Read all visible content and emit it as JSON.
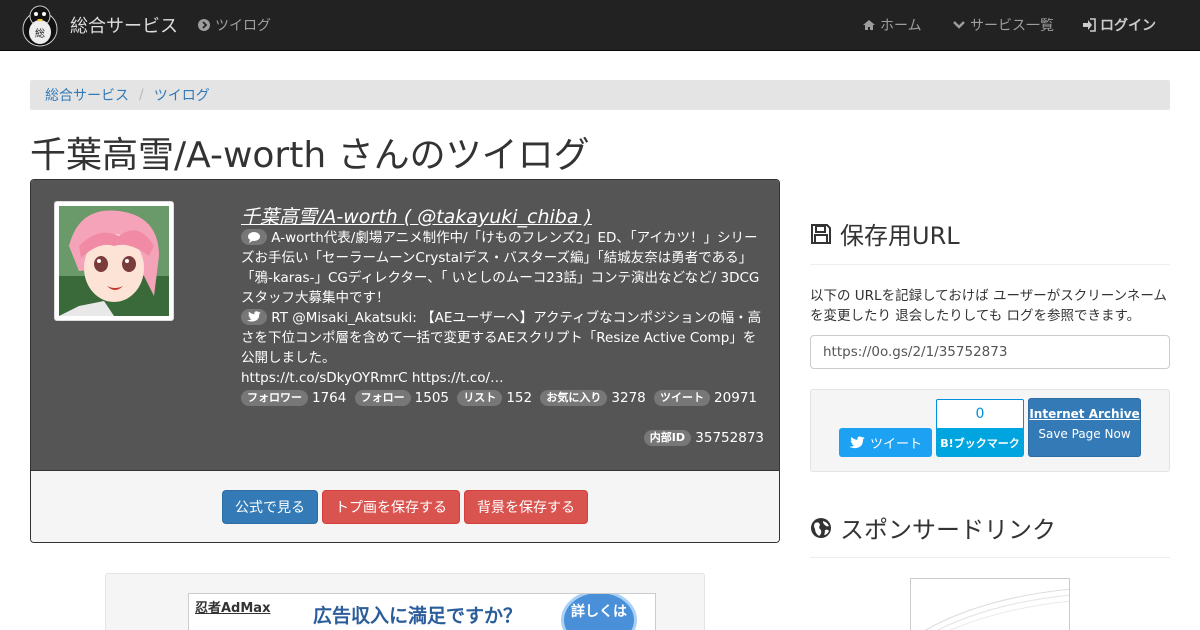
{
  "nav": {
    "brand": "総合サービス",
    "service": "ツイログ",
    "home": "ホーム",
    "services_list": "サービス一覧",
    "login": "ログイン"
  },
  "breadcrumb": [
    "総合サービス",
    "ツイログ"
  ],
  "page_title": "千葉高雪/A-worth さんのツイログ",
  "profile": {
    "name_line": "千葉高雪/A-worth ( @takayuki_chiba )",
    "bio": "A-worth代表/劇場アニメ制作中/「けものフレンズ2」ED、「アイカツ！」シリーズお手伝い「セーラームーンCrystalデス・バスターズ編」「結城友奈は勇者である」「鴉-karas-」CGディレクター、「 いとしのムーコ23話」コンテ演出などなど/ 3DCGスタッフ大募集中です！",
    "tweet": "RT @Misaki_Akatsuki: 【AEユーザーへ】アクティブなコンポジションの幅・高さを下位コンポ層を含めて一括で変更するAEスクリプト「Resize Active Comp」を公開しました。",
    "tweet_links": "https://t.co/sDkyOYRmrC https://t.co/…",
    "stats": [
      {
        "label": "フォロワー",
        "value": "1764"
      },
      {
        "label": "フォロー",
        "value": "1505"
      },
      {
        "label": "リスト",
        "value": "152"
      },
      {
        "label": "お気に入り",
        "value": "3278"
      },
      {
        "label": "ツイート",
        "value": "20971"
      }
    ],
    "inner_id_label": "内部ID",
    "inner_id": "35752873"
  },
  "actions": {
    "official": "公式で見る",
    "save_top": "トプ画を保存する",
    "save_bg": "背景を保存する"
  },
  "ad": {
    "logo": "忍者AdMax",
    "text": "広告収入に満足ですか？",
    "circle": "詳しくは"
  },
  "sidebar": {
    "save_url_title": "保存用URL",
    "save_url_desc": "以下の URLを記録しておけば ユーザーがスクリーンネームを変更したり 退会したりしても ログを参照できます。",
    "save_url": "https://0o.gs/2/1/35752873",
    "tweet_btn": "ツイート",
    "hatena_count": "0",
    "hatena_btn": "B!ブックマーク",
    "ia_title": "Internet Archive",
    "ia_sub": "Save Page Now",
    "sponsor_title": "スポンサードリンク"
  }
}
